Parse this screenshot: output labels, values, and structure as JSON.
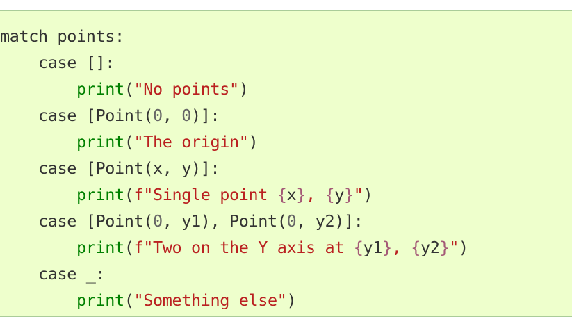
{
  "code": {
    "lines": [
      [
        {
          "t": "match",
          "c": "kw"
        },
        {
          "t": " points:",
          "c": "punc"
        }
      ],
      [
        {
          "t": "    ",
          "c": "punc"
        },
        {
          "t": "case",
          "c": "kw"
        },
        {
          "t": " []:",
          "c": "punc"
        }
      ],
      [
        {
          "t": "        ",
          "c": "punc"
        },
        {
          "t": "print",
          "c": "builtin"
        },
        {
          "t": "(",
          "c": "punc"
        },
        {
          "t": "\"No points\"",
          "c": "str"
        },
        {
          "t": ")",
          "c": "punc"
        }
      ],
      [
        {
          "t": "    ",
          "c": "punc"
        },
        {
          "t": "case",
          "c": "kw"
        },
        {
          "t": " [Point(",
          "c": "punc"
        },
        {
          "t": "0",
          "c": "num"
        },
        {
          "t": ", ",
          "c": "punc"
        },
        {
          "t": "0",
          "c": "num"
        },
        {
          "t": ")]:",
          "c": "punc"
        }
      ],
      [
        {
          "t": "        ",
          "c": "punc"
        },
        {
          "t": "print",
          "c": "builtin"
        },
        {
          "t": "(",
          "c": "punc"
        },
        {
          "t": "\"The origin\"",
          "c": "str"
        },
        {
          "t": ")",
          "c": "punc"
        }
      ],
      [
        {
          "t": "    ",
          "c": "punc"
        },
        {
          "t": "case",
          "c": "kw"
        },
        {
          "t": " [Point(x, y)]:",
          "c": "punc"
        }
      ],
      [
        {
          "t": "        ",
          "c": "punc"
        },
        {
          "t": "print",
          "c": "builtin"
        },
        {
          "t": "(",
          "c": "punc"
        },
        {
          "t": "f\"Single point ",
          "c": "str"
        },
        {
          "t": "{",
          "c": "interp"
        },
        {
          "t": "x",
          "c": "punc"
        },
        {
          "t": "}",
          "c": "interp"
        },
        {
          "t": ", ",
          "c": "str"
        },
        {
          "t": "{",
          "c": "interp"
        },
        {
          "t": "y",
          "c": "punc"
        },
        {
          "t": "}",
          "c": "interp"
        },
        {
          "t": "\"",
          "c": "str"
        },
        {
          "t": ")",
          "c": "punc"
        }
      ],
      [
        {
          "t": "    ",
          "c": "punc"
        },
        {
          "t": "case",
          "c": "kw"
        },
        {
          "t": " [Point(",
          "c": "punc"
        },
        {
          "t": "0",
          "c": "num"
        },
        {
          "t": ", y1), Point(",
          "c": "punc"
        },
        {
          "t": "0",
          "c": "num"
        },
        {
          "t": ", y2)]:",
          "c": "punc"
        }
      ],
      [
        {
          "t": "        ",
          "c": "punc"
        },
        {
          "t": "print",
          "c": "builtin"
        },
        {
          "t": "(",
          "c": "punc"
        },
        {
          "t": "f\"Two on the Y axis at ",
          "c": "str"
        },
        {
          "t": "{",
          "c": "interp"
        },
        {
          "t": "y1",
          "c": "punc"
        },
        {
          "t": "}",
          "c": "interp"
        },
        {
          "t": ", ",
          "c": "str"
        },
        {
          "t": "{",
          "c": "interp"
        },
        {
          "t": "y2",
          "c": "punc"
        },
        {
          "t": "}",
          "c": "interp"
        },
        {
          "t": "\"",
          "c": "str"
        },
        {
          "t": ")",
          "c": "punc"
        }
      ],
      [
        {
          "t": "    ",
          "c": "punc"
        },
        {
          "t": "case",
          "c": "kw"
        },
        {
          "t": " _:",
          "c": "punc"
        }
      ],
      [
        {
          "t": "        ",
          "c": "punc"
        },
        {
          "t": "print",
          "c": "builtin"
        },
        {
          "t": "(",
          "c": "punc"
        },
        {
          "t": "\"Something else\"",
          "c": "str"
        },
        {
          "t": ")",
          "c": "punc"
        }
      ]
    ]
  },
  "colors": {
    "background": "#eeffcc",
    "border": "#aacc99",
    "builtin": "#008000",
    "string": "#ba2121",
    "interpolation": "#a45a77",
    "text": "#333333"
  }
}
